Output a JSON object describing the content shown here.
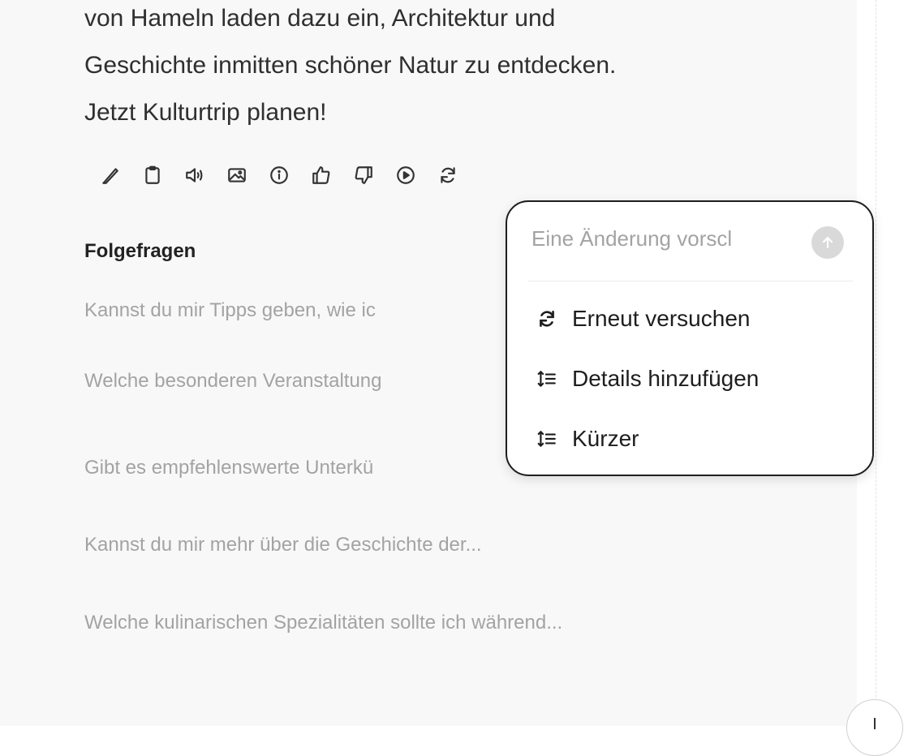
{
  "message": {
    "lines": [
      "von Hameln laden dazu ein, Architektur und",
      "Geschichte inmitten schöner Natur zu entdecken.",
      "Jetzt Kulturtrip planen!"
    ]
  },
  "action_icons": [
    "pencil-icon",
    "clipboard-icon",
    "speaker-icon",
    "image-icon",
    "info-icon",
    "thumbs-up-icon",
    "thumbs-down-icon",
    "play-icon",
    "refresh-icon"
  ],
  "followups": {
    "title": "Folgefragen",
    "items": [
      "Kannst du mir Tipps geben, wie ic",
      "Welche besonderen Veranstaltung",
      "Gibt es empfehlenswerte Unterkü",
      "Kannst du mir mehr über die Geschichte der...",
      "Welche kulinarischen Spezialitäten sollte ich während..."
    ]
  },
  "popup": {
    "placeholder": "Eine Änderung vorscl",
    "send_icon": "arrow-up-icon",
    "items": [
      {
        "icon": "refresh-icon",
        "label": "Erneut versuchen"
      },
      {
        "icon": "expand-lines-icon",
        "label": "Details hinzufügen"
      },
      {
        "icon": "expand-lines-icon",
        "label": "Kürzer"
      }
    ]
  },
  "colors": {
    "panel_bg": "#f8f8f8",
    "text_primary": "#2f2f2f",
    "text_muted": "#a3a3a3",
    "popup_border": "#1e1e1e",
    "send_button_bg": "#d9d9d9"
  }
}
